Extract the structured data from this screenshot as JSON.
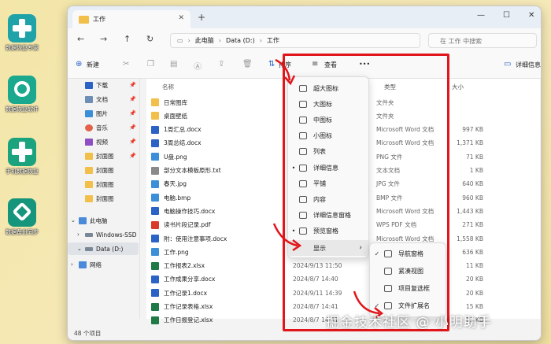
{
  "desktop": {
    "icons": [
      {
        "label": "数据恢复专家",
        "color": "#1fa3a8"
      },
      {
        "label": "数据恢复软件",
        "color": "#1aa88e"
      },
      {
        "label": "手机数据恢复",
        "color": "#1ba37e"
      },
      {
        "label": "数据备份同步",
        "color": "#14957c"
      }
    ]
  },
  "window": {
    "tab_title": "工作",
    "tab_close": "✕",
    "new_tab": "+",
    "controls": {
      "minimize": "—",
      "maximize": "☐",
      "close": "✕"
    }
  },
  "addressbar": {
    "back": "←",
    "forward": "→",
    "up": "↑",
    "refresh": "↻",
    "monitor": "▭",
    "crumbs": [
      "此电脑",
      "Data (D:)",
      "工作"
    ],
    "sep": "›",
    "search_placeholder": "在 工作 中搜索"
  },
  "toolbar": {
    "new_label": "新建",
    "sort_label": "排序",
    "view_label": "查看",
    "more": "•••",
    "details_label": "详细信息"
  },
  "sidebar": {
    "items": [
      {
        "label": "下载",
        "pin": true
      },
      {
        "label": "文档",
        "pin": true
      },
      {
        "label": "图片",
        "pin": true
      },
      {
        "label": "音乐",
        "pin": true
      },
      {
        "label": "视频",
        "pin": true
      },
      {
        "label": "封面图",
        "pin": true
      },
      {
        "label": "封面图",
        "pin": false
      },
      {
        "label": "封面图",
        "pin": false
      },
      {
        "label": "封面图",
        "pin": false
      },
      {
        "label": "此电脑",
        "pin": false
      },
      {
        "label": "Windows-SSD",
        "pin": false
      },
      {
        "label": "Data (D:)",
        "pin": false
      },
      {
        "label": "网络",
        "pin": false
      }
    ]
  },
  "columns": {
    "name": "名称",
    "type": "类型",
    "size": "大小"
  },
  "files": [
    {
      "name": "日常图库",
      "date": "",
      "type": "文件夹",
      "size": "",
      "kind": "folder"
    },
    {
      "name": "桌面壁纸",
      "date": "",
      "type": "文件夹",
      "size": "",
      "kind": "folder"
    },
    {
      "name": "1周汇总.docx",
      "date": "",
      "type": "Microsoft Word 文档",
      "size": "997 KB",
      "kind": "word"
    },
    {
      "name": "3周总结.docx",
      "date": "",
      "type": "Microsoft Word 文档",
      "size": "1,371 KB",
      "kind": "word"
    },
    {
      "name": "U盘.png",
      "date": "",
      "type": "PNG 文件",
      "size": "71 KB",
      "kind": "image"
    },
    {
      "name": "部分文本模板原形.txt",
      "date": "",
      "type": "文本文档",
      "size": "1 KB",
      "kind": "text"
    },
    {
      "name": "春天.jpg",
      "date": "",
      "type": "JPG 文件",
      "size": "640 KB",
      "kind": "image"
    },
    {
      "name": "电脑.bmp",
      "date": "",
      "type": "BMP 文件",
      "size": "960 KB",
      "kind": "image"
    },
    {
      "name": "电脑操作技巧.docx",
      "date": "",
      "type": "Microsoft Word 文档",
      "size": "1,443 KB",
      "kind": "word"
    },
    {
      "name": "读书片段记录.pdf",
      "date": "",
      "type": "WPS PDF 文档",
      "size": "271 KB",
      "kind": "pdf"
    },
    {
      "name": "附：使用注意事项.docx",
      "date": "",
      "type": "Microsoft Word 文档",
      "size": "1,558 KB",
      "kind": "word"
    },
    {
      "name": "工作.png",
      "date": "",
      "type": "",
      "size": "636 KB",
      "kind": "image"
    },
    {
      "name": "工作报表2.xlsx",
      "date": "2024/9/13 11:50",
      "type": "",
      "size": "11 KB",
      "kind": "excel"
    },
    {
      "name": "工作成果分享.docx",
      "date": "2024/8/7 14:40",
      "type": "",
      "size": "20 KB",
      "kind": "word"
    },
    {
      "name": "工作记录1.docx",
      "date": "2024/9/11 14:39",
      "type": "",
      "size": "20 KB",
      "kind": "word"
    },
    {
      "name": "工作记录表格.xlsx",
      "date": "2024/8/7 14:41",
      "type": "",
      "size": "15 KB",
      "kind": "excel"
    },
    {
      "name": "工作日报登记.xlsx",
      "date": "2024/8/7 14:41",
      "type": "",
      "size": "13 KB",
      "kind": "excel"
    }
  ],
  "status": "48 个项目",
  "view_menu": {
    "items": [
      {
        "label": "超大图标",
        "checked": false
      },
      {
        "label": "大图标",
        "checked": false
      },
      {
        "label": "中图标",
        "checked": false
      },
      {
        "label": "小图标",
        "checked": false
      },
      {
        "label": "列表",
        "checked": false
      },
      {
        "label": "详细信息",
        "checked": true
      },
      {
        "label": "平铺",
        "checked": false
      },
      {
        "label": "内容",
        "checked": false
      },
      {
        "label": "详细信息窗格",
        "checked": false
      },
      {
        "label": "预览窗格",
        "checked": true
      },
      {
        "label": "显示",
        "checked": false,
        "submenu": true
      }
    ]
  },
  "show_submenu": {
    "items": [
      {
        "label": "导航窗格",
        "checked": true
      },
      {
        "label": "紧凑视图",
        "checked": false
      },
      {
        "label": "项目复选框",
        "checked": false
      },
      {
        "label": "文件扩展名",
        "checked": true
      }
    ]
  },
  "watermark": "掘金技术社区 @ 小明助手",
  "colors": {
    "highlight": "#e0161b",
    "folder": "#f2c04a",
    "word": "#2b62c6",
    "excel": "#1f7a45",
    "pdf": "#d93b2b",
    "image": "#3b8fd8"
  }
}
